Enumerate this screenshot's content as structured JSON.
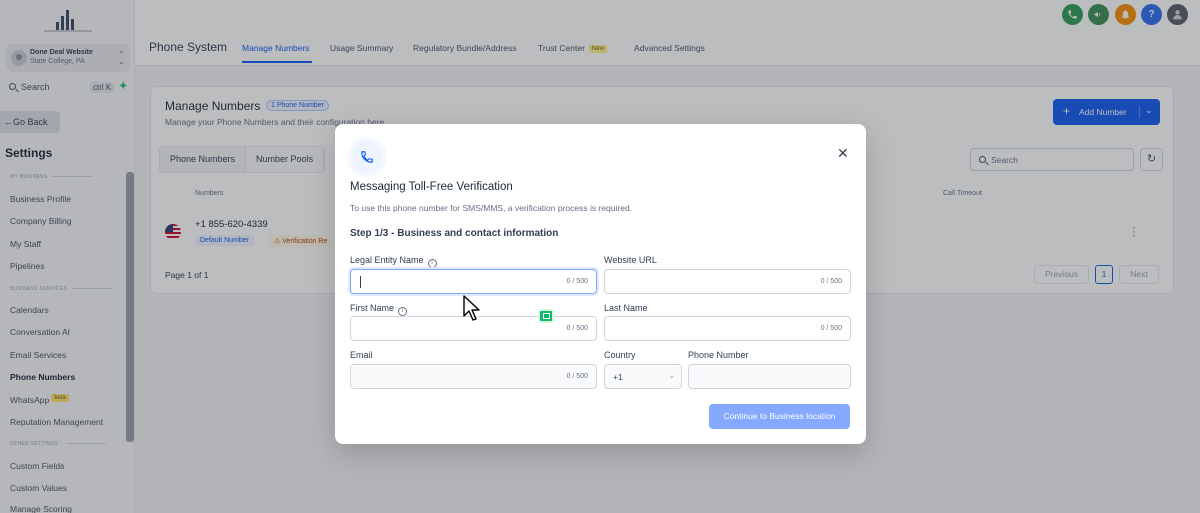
{
  "sidebar": {
    "location_name": "Done Deal Website",
    "location_address": "State College, PA",
    "search_label": "Search",
    "search_shortcut": "ctrl K",
    "go_back": "Go Back",
    "title": "Settings",
    "section_my_business": "MY BUSINESS",
    "section_business_services": "BUSINESS SERVICES",
    "section_other_settings": "OTHER SETTINGS",
    "items": [
      {
        "label": "Business Profile"
      },
      {
        "label": "Company Billing"
      },
      {
        "label": "My Staff"
      },
      {
        "label": "Pipelines"
      },
      {
        "label": "Calendars"
      },
      {
        "label": "Conversation AI"
      },
      {
        "label": "Email Services"
      },
      {
        "label": "Phone Numbers"
      },
      {
        "label": "WhatsApp",
        "badge": "beta"
      },
      {
        "label": "Reputation Management"
      },
      {
        "label": "Custom Fields"
      },
      {
        "label": "Custom Values"
      },
      {
        "label": "Manage Scoring"
      }
    ]
  },
  "header": {
    "title": "Phone System",
    "tabs": [
      {
        "label": "Manage Numbers",
        "active": true
      },
      {
        "label": "Usage Summary"
      },
      {
        "label": "Regulatory Bundle/Address"
      },
      {
        "label": "Trust Center",
        "badge": "New"
      },
      {
        "label": "Advanced Settings"
      }
    ],
    "icons": [
      "phone-icon",
      "megaphone-icon",
      "bell-icon",
      "help-icon",
      "user-avatar"
    ],
    "help_label": "?",
    "colors": {
      "phone": "#2e9e5b",
      "megaphone": "#3f8f58",
      "bell": "#f79009",
      "help": "#2f6fed"
    }
  },
  "card": {
    "title": "Manage Numbers",
    "count_badge": "1 Phone Number",
    "subtitle": "Manage your Phone Numbers and their configuration here",
    "add_button": "Add Number",
    "segments": [
      "Phone Numbers",
      "Number Pools"
    ],
    "search_placeholder": "Search",
    "columns": {
      "numbers": "Numbers",
      "call_timeout": "Call Timeout"
    },
    "rows": [
      {
        "number": "+1 855-620-4339",
        "badge": "Default Number",
        "warning": "Verification Re"
      }
    ],
    "page_info": "Page 1 of 1",
    "prev": "Previous",
    "current_page": "1",
    "next": "Next"
  },
  "modal": {
    "title": "Messaging Toll-Free Verification",
    "description": "To use this phone number for SMS/MMS, a verification process is required.",
    "step": "Step 1/3 - Business and contact information",
    "fields": {
      "legal_entity_name": {
        "label": "Legal Entity Name",
        "counter": "0 / 500"
      },
      "website_url": {
        "label": "Website URL",
        "counter": "0 / 500"
      },
      "first_name": {
        "label": "First Name",
        "counter": "0 / 500"
      },
      "last_name": {
        "label": "Last Name",
        "counter": "0 / 500"
      },
      "email": {
        "label": "Email",
        "counter": "0 / 500"
      },
      "country": {
        "label": "Country",
        "value": "+1"
      },
      "phone_number": {
        "label": "Phone Number"
      }
    },
    "continue_button": "Continue to Business location",
    "accent_color": "#155eef"
  }
}
